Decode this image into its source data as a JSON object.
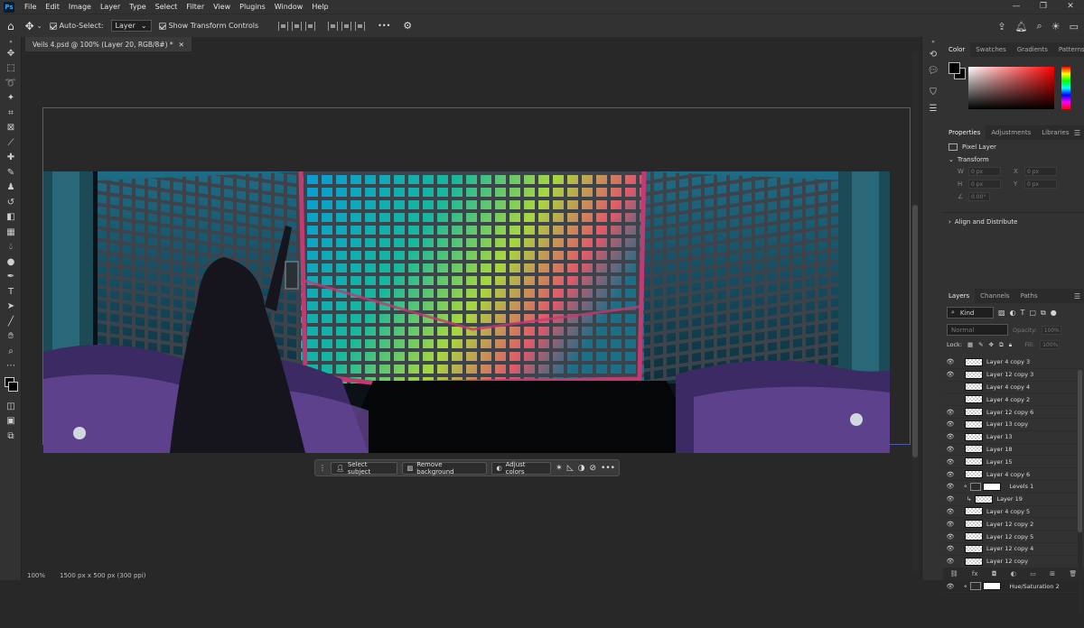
{
  "app": {
    "logo": "Ps"
  },
  "menu": [
    "File",
    "Edit",
    "Image",
    "Layer",
    "Type",
    "Select",
    "Filter",
    "View",
    "Plugins",
    "Window",
    "Help"
  ],
  "window_controls": {
    "minimize": "—",
    "restore": "❐",
    "close": "✕"
  },
  "options_bar": {
    "auto_select_label": "Auto-Select:",
    "auto_select_target": "Layer",
    "show_transform_label": "Show Transform Controls",
    "more": "•••"
  },
  "doc_tab": {
    "title": "Veils 4.psd @ 100% (Layer 20, RGB/8#) *",
    "close": "✕"
  },
  "context_bar": {
    "select_subject": "Select subject",
    "remove_background": "Remove background",
    "adjust_colors": "Adjust colors",
    "more": "•••"
  },
  "status": {
    "zoom": "100%",
    "doc_info": "1500 px x 500 px (300 ppi)"
  },
  "panels": {
    "color_tabs": [
      "Color",
      "Swatches",
      "Gradients",
      "Patterns"
    ],
    "props_tabs": [
      "Properties",
      "Adjustments",
      "Libraries"
    ],
    "layers_tabs": [
      "Layers",
      "Channels",
      "Paths"
    ]
  },
  "properties": {
    "type": "Pixel Layer",
    "transform_title": "Transform",
    "w_label": "W",
    "w_value": "0 px",
    "x_label": "X",
    "x_value": "0 px",
    "h_label": "H",
    "h_value": "0 px",
    "y_label": "Y",
    "y_value": "0 px",
    "angle_value": "0.00°",
    "align_title": "Align and Distribute"
  },
  "layers_ctrl": {
    "filter_kind": "Kind",
    "blend_mode": "Normal",
    "opacity_label": "Opacity:",
    "opacity_value": "100%",
    "lock_label": "Lock:",
    "fill_label": "Fill:",
    "fill_value": "100%"
  },
  "layers": [
    {
      "name": "Layer 4 copy 3",
      "visible": true,
      "kind": "pixel"
    },
    {
      "name": "Layer 12 copy 3",
      "visible": true,
      "kind": "pixel"
    },
    {
      "name": "Layer 4 copy 4",
      "visible": false,
      "kind": "pixel"
    },
    {
      "name": "Layer 4 copy 2",
      "visible": false,
      "kind": "pixel"
    },
    {
      "name": "Layer 12 copy 6",
      "visible": true,
      "kind": "pixel"
    },
    {
      "name": "Layer 13 copy",
      "visible": true,
      "kind": "pixel"
    },
    {
      "name": "Layer 13",
      "visible": true,
      "kind": "pixel"
    },
    {
      "name": "Layer 18",
      "visible": true,
      "kind": "pixel"
    },
    {
      "name": "Layer 15",
      "visible": true,
      "kind": "pixel"
    },
    {
      "name": "Layer 4 copy 6",
      "visible": true,
      "kind": "pixel"
    },
    {
      "name": "Levels 1",
      "visible": true,
      "kind": "adjustment"
    },
    {
      "name": "Layer 19",
      "visible": true,
      "kind": "clipped"
    },
    {
      "name": "Layer 4 copy 5",
      "visible": true,
      "kind": "pixel"
    },
    {
      "name": "Layer 12 copy 2",
      "visible": true,
      "kind": "pixel"
    },
    {
      "name": "Layer 12 copy 5",
      "visible": true,
      "kind": "pixel"
    },
    {
      "name": "Layer 12 copy 4",
      "visible": true,
      "kind": "pixel"
    },
    {
      "name": "Layer 12 copy",
      "visible": true,
      "kind": "pixel"
    },
    {
      "name": "Layer 13 copy 2",
      "visible": true,
      "kind": "pixel"
    },
    {
      "name": "Hue/Saturation 2",
      "visible": true,
      "kind": "adjustment"
    }
  ]
}
